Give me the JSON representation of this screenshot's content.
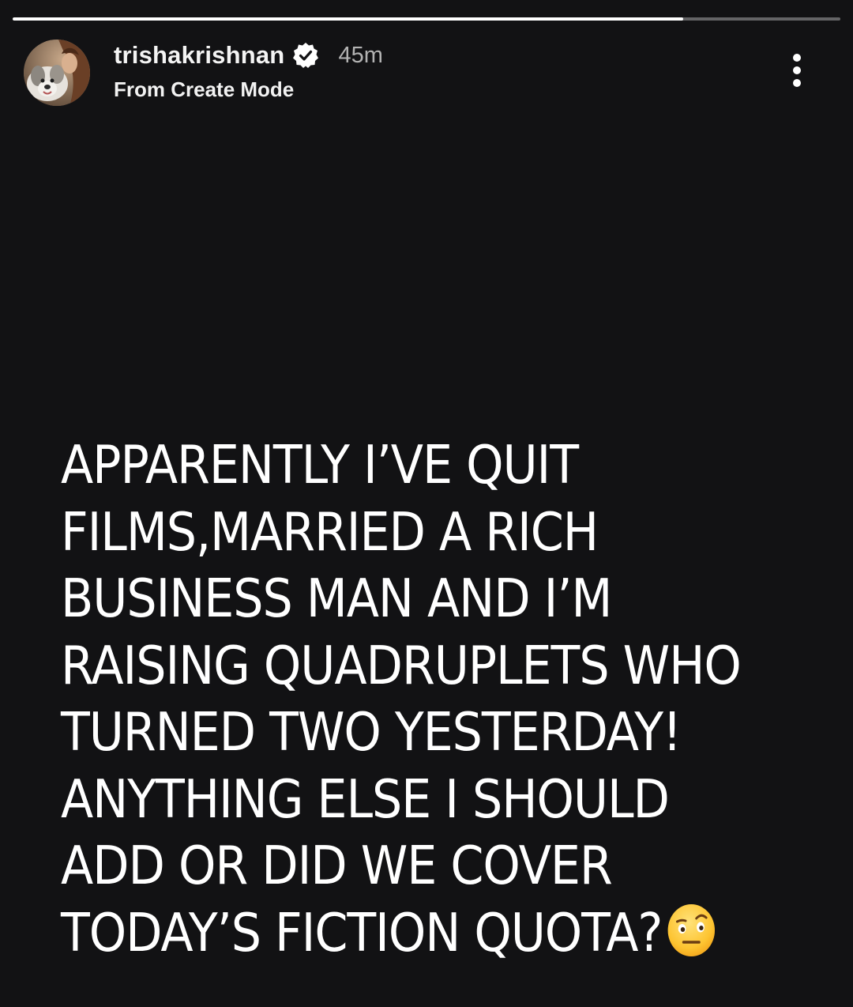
{
  "story": {
    "progress": 0.81,
    "username": "trishakrishnan",
    "verified": true,
    "time": "45m",
    "subtitle": "From Create Mode",
    "text_lines": [
      "APPARENTLY I’VE QUIT",
      "FILMS,MARRIED A RICH",
      "BUSINESS MAN AND I’M",
      "RAISING QUADRUPLETS WHO",
      "TURNED TWO YESTERDAY!",
      "ANYTHING ELSE I SHOULD",
      "ADD OR DID WE COVER",
      "TODAY’S FICTION QUOTA?"
    ],
    "trailing_emoji": "face-with-raised-eyebrow-icon"
  },
  "colors": {
    "background": "#121214",
    "text": "#ffffff",
    "time": "#b3b3b3",
    "verified_badge": "#ffffff"
  },
  "icons": {
    "more": "more-vertical-icon",
    "verified": "verified-badge-icon",
    "avatar": "avatar"
  }
}
